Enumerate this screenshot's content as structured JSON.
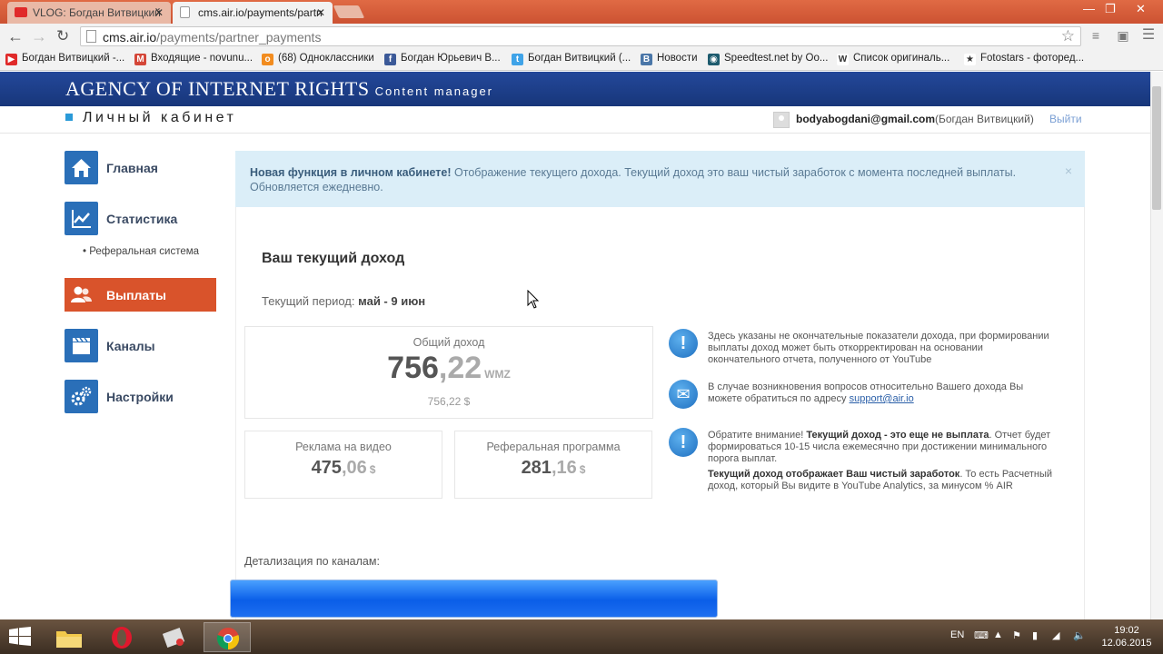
{
  "browser": {
    "tabs": [
      {
        "title": "VLOG: Богдан Витвицкий",
        "active": false,
        "favicon": "youtube-icon"
      },
      {
        "title": "cms.air.io/payments/partn",
        "active": true,
        "favicon": "page-icon"
      }
    ],
    "url_host": "cms.air.io",
    "url_path": "/payments/partner_payments",
    "bookmarks": [
      {
        "label": "Богдан Витвицкий -...",
        "icon": "youtube-icon",
        "color": "#e02a2a",
        "glyph": "▶"
      },
      {
        "label": "Входящие - novunu...",
        "icon": "gmail-icon",
        "color": "#d44638",
        "glyph": "M"
      },
      {
        "label": "(68) Одноклассники",
        "icon": "ok-icon",
        "color": "#f28c1f",
        "glyph": "о"
      },
      {
        "label": "Богдан Юрьевич В...",
        "icon": "facebook-icon",
        "color": "#3b5998",
        "glyph": "f"
      },
      {
        "label": "Богдан Витвицкий (...",
        "icon": "twitter-icon",
        "color": "#3fa3e8",
        "glyph": "t"
      },
      {
        "label": "Новости",
        "icon": "vk-icon",
        "color": "#4a76a8",
        "glyph": "В"
      },
      {
        "label": "Speedtest.net by Oo...",
        "icon": "speedtest-icon",
        "color": "#1d5b6e",
        "glyph": "◉"
      },
      {
        "label": "Список оригиналь...",
        "icon": "wikipedia-icon",
        "color": "#ffffff",
        "glyph": "W"
      },
      {
        "label": "Fotostars - фоторед...",
        "icon": "star-icon",
        "color": "#ffffff",
        "glyph": "★"
      }
    ]
  },
  "site": {
    "logo_text": "AGENCY OF INTERNET RIGHTS",
    "logo_sub": "Content manager",
    "cabinet_title": "Личный кабинет",
    "user_email": "bodyabogdani@gmail.com",
    "user_name": "(Богдан Витвицкий)",
    "logout": "Выйти"
  },
  "sidebar": {
    "items": [
      {
        "label": "Главная",
        "icon": "home-icon"
      },
      {
        "label": "Статистика",
        "icon": "chart-icon"
      },
      {
        "label": "Выплаты",
        "icon": "users-icon",
        "active": true
      },
      {
        "label": "Каналы",
        "icon": "clapperboard-icon"
      },
      {
        "label": "Настройки",
        "icon": "gears-icon"
      }
    ],
    "subitem": "• Реферальная система"
  },
  "alert": {
    "bold": "Новая функция в личном кабинете!",
    "text": " Отображение текущего дохода. Текущий доход это ваш чистый заработок с момента последней выплаты. Обновляется ежедневно.",
    "close": "×"
  },
  "income": {
    "title": "Ваш текущий доход",
    "period_label": "Текущий период:",
    "period_value": "май - 9 июн",
    "total_label": "Общий доход",
    "total_int": "756",
    "total_cents": ",22",
    "total_currency": "WMZ",
    "total_usd": "756,22 $",
    "ads_label": "Реклама на видео",
    "ads_int": "475",
    "ads_cents": ",06",
    "ads_currency": "$",
    "ref_label": "Реферальная программа",
    "ref_int": "281",
    "ref_cents": ",16",
    "ref_currency": "$"
  },
  "notes": [
    {
      "icon": "info-icon",
      "text": "Здесь указаны не окончательные показатели дохода, при формировании выплаты доход может быть откорректирован на основании окончательного отчета, полученного от YouTube"
    },
    {
      "icon": "mail-icon",
      "text_before": "В случае возникновения вопросов относительно Вашего дохода Вы можете обратиться по адресу ",
      "link": "support@air.io"
    },
    {
      "icon": "info-icon",
      "p1_before": "Обратите внимание! ",
      "p1_bold": "Текущий доход - это еще не выплата",
      "p1_after": ". Отчет будет формироваться 10-15 числа ежемесячно при достижении минимального порога выплат.",
      "p2_bold": "Текущий доход отображает Ваш чистый заработок",
      "p2_after": ". То есть Расчетный доход, который Вы видите в YouTube Analytics, за минусом % AIR"
    }
  ],
  "detail_label": "Детализация по каналам:",
  "taskbar": {
    "lang": "EN",
    "time": "19:02",
    "date": "12.06.2015"
  },
  "colors": {
    "header_blue": "#1d3f88",
    "active_orange": "#d9532b",
    "alert_bg": "#dbeef8",
    "sidebar_icon_blue": "#2a6fb8"
  }
}
